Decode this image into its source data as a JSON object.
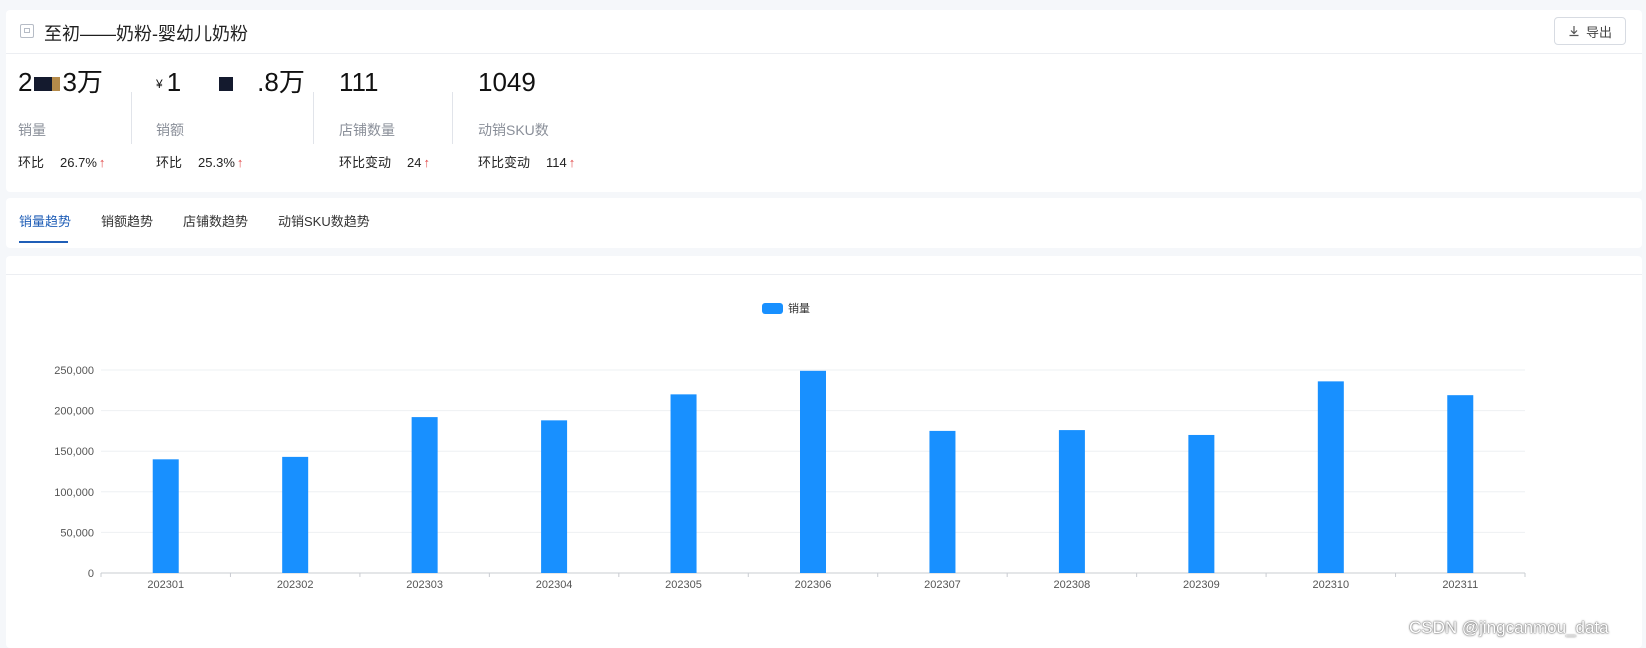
{
  "header": {
    "title": "至初——奶粉-婴幼儿奶粉",
    "export_label": "导出"
  },
  "metrics": [
    {
      "value_prefix": "2",
      "value_suffix": "3万",
      "label": "销量",
      "change_label": "环比",
      "change_value": "26.7%",
      "arrow": "↑"
    },
    {
      "currency": "¥",
      "value_prefix": "1",
      "value_suffix": ".8万",
      "label": "销额",
      "change_label": "环比",
      "change_value": "25.3%",
      "arrow": "↑"
    },
    {
      "value": "111",
      "label": "店铺数量",
      "change_label": "环比变动",
      "change_value": "24",
      "arrow": "↑"
    },
    {
      "value": "1049",
      "label": "动销SKU数",
      "change_label": "环比变动",
      "change_value": "114",
      "arrow": "↑"
    }
  ],
  "tabs": [
    {
      "label": "销量趋势",
      "active": true
    },
    {
      "label": "销额趋势",
      "active": false
    },
    {
      "label": "店铺数趋势",
      "active": false
    },
    {
      "label": "动销SKU数趋势",
      "active": false
    }
  ],
  "chart_data": {
    "type": "bar",
    "categories": [
      "202301",
      "202302",
      "202303",
      "202304",
      "202305",
      "202306",
      "202307",
      "202308",
      "202309",
      "202310",
      "202311"
    ],
    "series": [
      {
        "name": "销量",
        "values": [
          140000,
          143000,
          192000,
          188000,
          220000,
          249000,
          175000,
          176000,
          170000,
          236000,
          219000
        ]
      }
    ],
    "yticks": [
      "0",
      "50,000",
      "100,000",
      "150,000",
      "200,000",
      "250,000"
    ],
    "ylim": [
      0,
      250000
    ],
    "legend_position": "top-center",
    "grid": true,
    "bar_color": "#1890ff"
  },
  "watermark": "CSDN @jingcanmou_data"
}
